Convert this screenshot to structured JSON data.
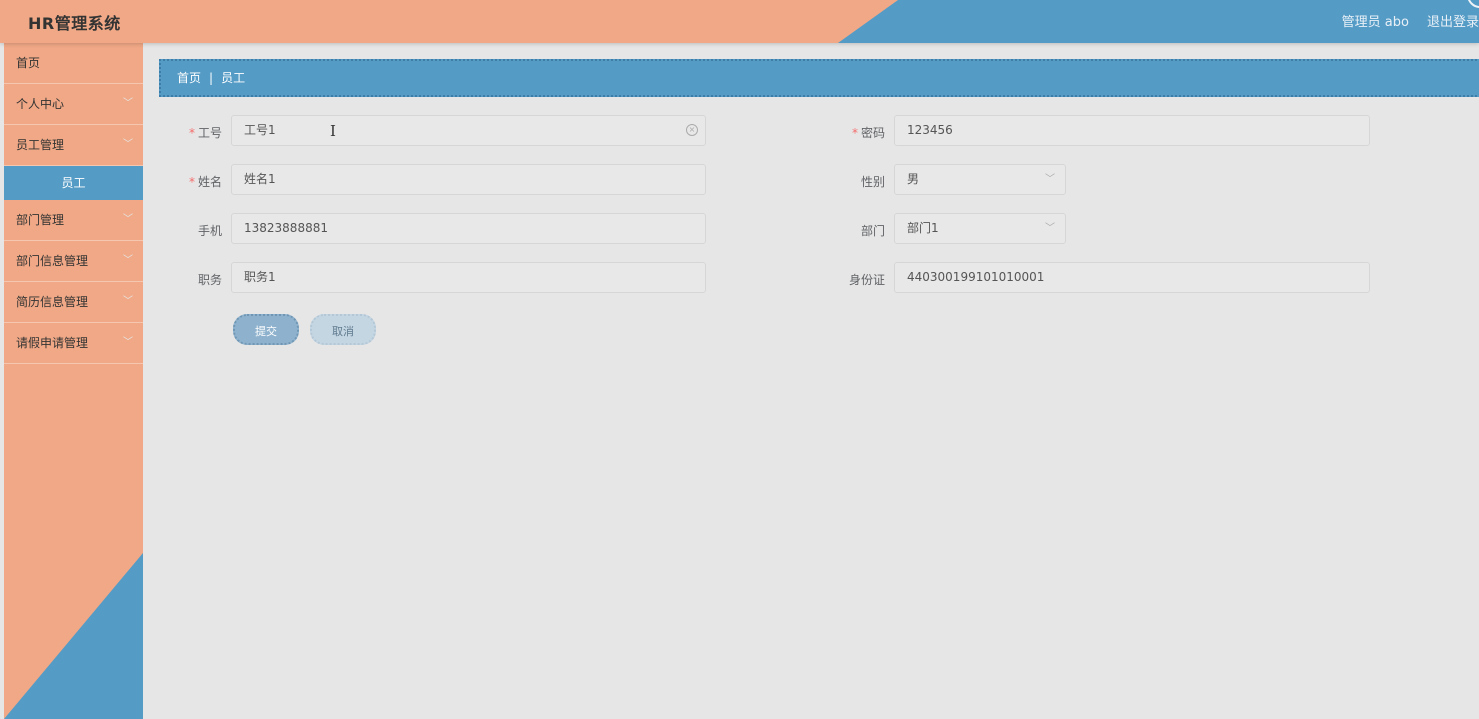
{
  "app": {
    "title": "HR管理系统"
  },
  "header": {
    "user": "管理员 abo",
    "logout": "退出登录"
  },
  "sidebar": {
    "items": [
      {
        "label": "首页",
        "chevron": false
      },
      {
        "label": "个人中心",
        "chevron": true
      },
      {
        "label": "员工管理",
        "chevron": true,
        "expanded": true,
        "children": [
          {
            "label": "员工",
            "active": true
          }
        ]
      },
      {
        "label": "部门管理",
        "chevron": true
      },
      {
        "label": "部门信息管理",
        "chevron": true
      },
      {
        "label": "简历信息管理",
        "chevron": true
      },
      {
        "label": "请假申请管理",
        "chevron": true
      }
    ]
  },
  "breadcrumb": {
    "home": "首页",
    "sep": "|",
    "current": "员工"
  },
  "form": {
    "employee_no": {
      "label": "工号",
      "required": true,
      "value": "工号1"
    },
    "password": {
      "label": "密码",
      "required": true,
      "value": "123456"
    },
    "name": {
      "label": "姓名",
      "required": true,
      "value": "姓名1"
    },
    "gender": {
      "label": "性别",
      "value": "男"
    },
    "phone": {
      "label": "手机",
      "value": "13823888881"
    },
    "department": {
      "label": "部门",
      "value": "部门1"
    },
    "position": {
      "label": "职务",
      "value": "职务1"
    },
    "id_card": {
      "label": "身份证",
      "value": "440300199101010001"
    }
  },
  "buttons": {
    "submit": "提交",
    "cancel": "取消"
  },
  "colors": {
    "salmon": "#f0a886",
    "blue": "#549bc6",
    "background": "#e6e6e6",
    "required": "#f56c6c"
  }
}
